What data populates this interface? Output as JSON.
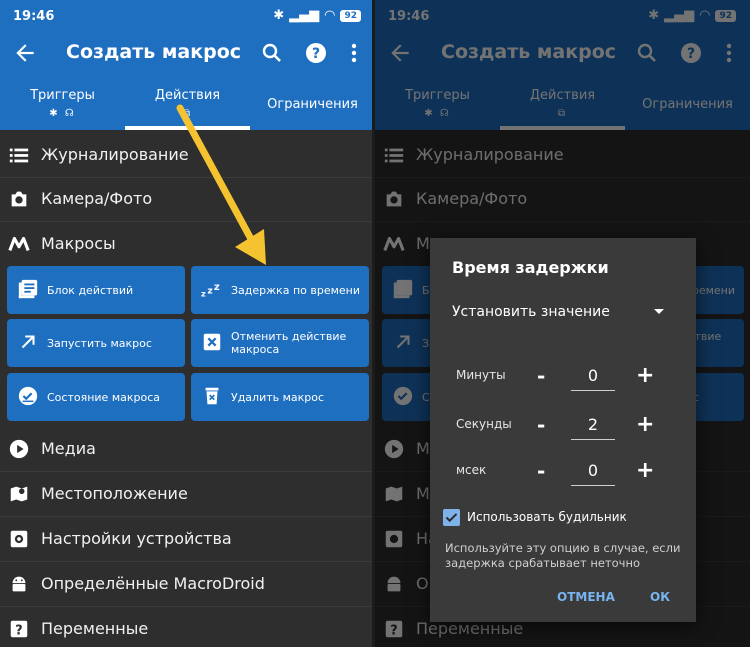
{
  "status": {
    "time": "19:46",
    "battery": "92"
  },
  "toolbar": {
    "title": "Создать макрос"
  },
  "tabs": [
    {
      "label": "Триггеры",
      "icons": "✱ ☊"
    },
    {
      "label": "Действия",
      "icons": "⧉"
    },
    {
      "label": "Ограничения"
    }
  ],
  "categories": [
    {
      "label": "Журналирование",
      "icon": "list-icon"
    },
    {
      "label": "Камера/Фото",
      "icon": "camera-icon"
    },
    {
      "label": "Макросы",
      "icon": "macrodroid-m-icon"
    },
    {
      "label": "Медиа",
      "icon": "play-icon"
    },
    {
      "label": "Местоположение",
      "icon": "map-icon"
    },
    {
      "label": "Настройки устройства",
      "icon": "settings-icon"
    },
    {
      "label": "Определённые MacroDroid",
      "icon": "android-icon"
    },
    {
      "label": "Переменные",
      "icon": "question-icon"
    }
  ],
  "actions": [
    {
      "label": "Блок действий",
      "icon": "action-block-icon"
    },
    {
      "label": "Задержка по времени",
      "icon": "zzz-icon"
    },
    {
      "label": "Запустить макрос",
      "icon": "arrow-up-right-icon"
    },
    {
      "label": "Отменить действие макроса",
      "icon": "cancel-box-icon"
    },
    {
      "label": "Состояние макроса",
      "icon": "check-circle-icon"
    },
    {
      "label": "Удалить макрос",
      "icon": "trash-icon"
    }
  ],
  "dialog": {
    "title": "Время задержки",
    "mode": "Установить значение",
    "fields": [
      {
        "label": "Минуты",
        "value": "0"
      },
      {
        "label": "Секунды",
        "value": "2"
      },
      {
        "label": "мсек",
        "value": "0"
      }
    ],
    "minus": "-",
    "plus": "+",
    "checkbox_label": "Использовать будильник",
    "checkbox_checked": true,
    "hint": "Используйте эту опцию в случае, если задержка срабатывает неточно",
    "cancel": "ОТМЕНА",
    "ok": "ОК"
  },
  "colors": {
    "accent": "#1f6fc1",
    "arrow": "#f6c330",
    "dialog_button": "#78b4f0"
  }
}
